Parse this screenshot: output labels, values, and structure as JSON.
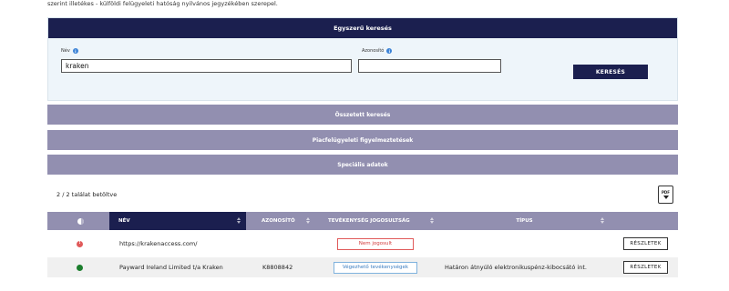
{
  "intro_text": "szerint illetékes - külföldi felügyeleti hatóság nyilvános jegyzékében szerepel.",
  "simple_search": {
    "title": "Egyszerű keresés",
    "name_label": "Név",
    "name_value": "kraken",
    "id_label": "Azonosító",
    "id_value": "",
    "search_button": "KERESÉS"
  },
  "sections": {
    "complex": "Összetett keresés",
    "alerts": "Piacfelügyeleti figyelmeztetések",
    "special": "Speciális adatok"
  },
  "results_count": "2 / 2 találat betöltve",
  "pdf_label": "PDF",
  "table": {
    "headers": {
      "name": "NÉV",
      "id": "AZONOSÍTÓ",
      "activity": "TEVÉKENYSÉG JOGOSULTSÁG",
      "type": "TÍPUS"
    },
    "rows": [
      {
        "status": "red",
        "name": "https://krakenaccess.com/",
        "id": "",
        "activity": "Nem jogosult",
        "type": "",
        "details": "RÉSZLETEK"
      },
      {
        "status": "green",
        "name": "Payward Ireland Limited t/a Kraken",
        "id": "K8808842",
        "activity": "Végezhető tevékenységek",
        "type": "Határon átnyúló elektronikuspénz-kibocsátó int.",
        "details": "RÉSZLETEK"
      }
    ]
  },
  "colors": {
    "navy": "#1b1f4f",
    "purple_gray": "#928fb0",
    "panel_bg": "#eef5fa",
    "status_red": "#e05a5a",
    "status_green": "#1b7d2c"
  }
}
